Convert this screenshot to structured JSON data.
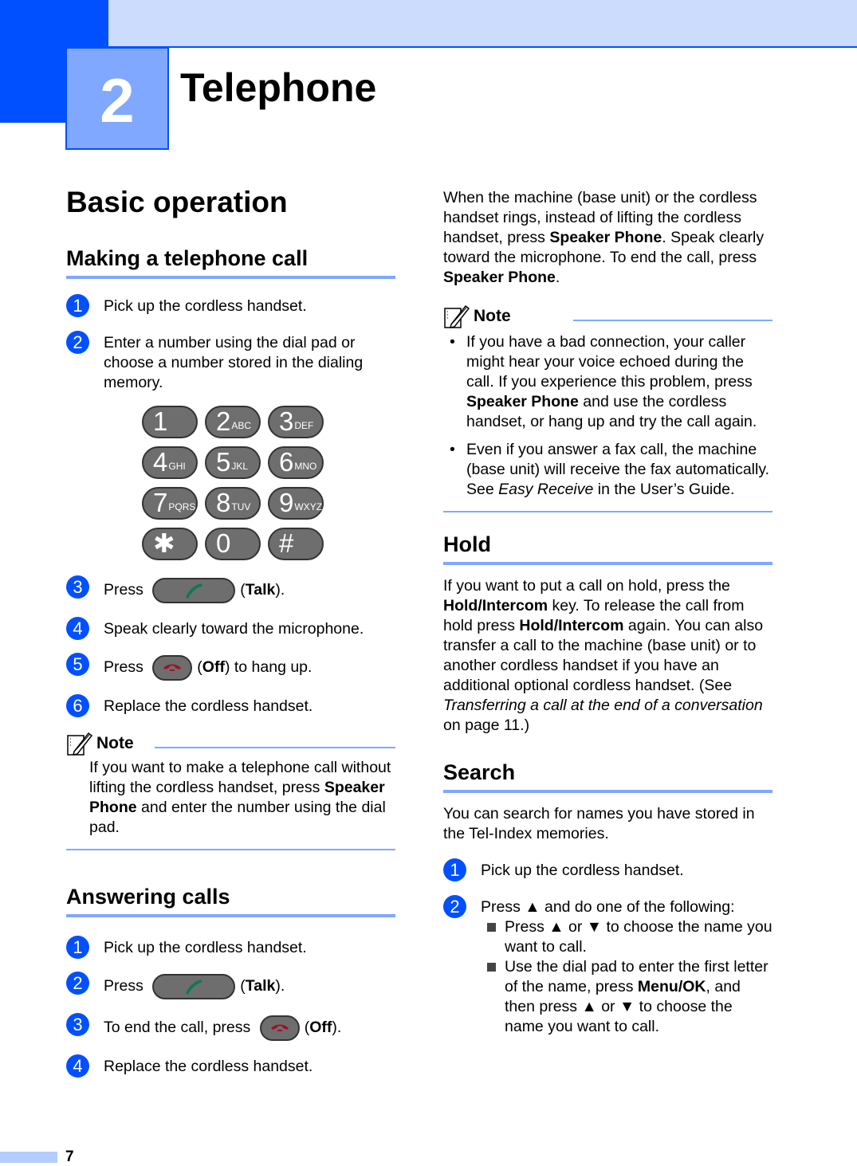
{
  "chapter": {
    "number": "2",
    "title": "Telephone"
  },
  "left": {
    "section_title": "Basic operation",
    "making_call": {
      "title": "Making a telephone call",
      "steps": [
        {
          "num": "1",
          "text": "Pick up the cordless handset."
        },
        {
          "num": "2",
          "text": "Enter a number using the dial pad or choose a number stored in the dialing memory."
        },
        {
          "num": "3",
          "pre": "Press",
          "btn": "talk",
          "bold": "Talk",
          "post": ")."
        },
        {
          "num": "4",
          "text": "Speak clearly toward the microphone."
        },
        {
          "num": "5",
          "pre": "Press",
          "btn": "off",
          "bold": "Off",
          "post": ") to hang up."
        },
        {
          "num": "6",
          "text": "Replace the cordless handset."
        }
      ],
      "keypad": [
        {
          "digit": "1",
          "letters": ""
        },
        {
          "digit": "2",
          "letters": "ABC"
        },
        {
          "digit": "3",
          "letters": "DEF"
        },
        {
          "digit": "4",
          "letters": "GHI"
        },
        {
          "digit": "5",
          "letters": "JKL"
        },
        {
          "digit": "6",
          "letters": "MNO"
        },
        {
          "digit": "7",
          "letters": "PQRS"
        },
        {
          "digit": "8",
          "letters": "TUV"
        },
        {
          "digit": "9",
          "letters": "WXYZ"
        },
        {
          "digit": "✱",
          "letters": ""
        },
        {
          "digit": "0",
          "letters": ""
        },
        {
          "digit": "#",
          "letters": ""
        }
      ],
      "note": {
        "label": "Note",
        "t1": "If you want to make a telephone call without lifting the cordless handset, press ",
        "b1": "Speaker Phone",
        "t2": " and enter the number using the dial pad."
      }
    },
    "answering": {
      "title": "Answering calls",
      "steps": [
        {
          "num": "1",
          "text": "Pick up the cordless handset."
        },
        {
          "num": "2",
          "pre": "Press",
          "bold": "Talk",
          "post": ")."
        },
        {
          "num": "3",
          "pre": "To end the call, press",
          "bold": "Off",
          "post": ")."
        },
        {
          "num": "4",
          "text": "Replace the cordless handset."
        }
      ]
    }
  },
  "right": {
    "speaker": {
      "t1": "When the machine (base unit) or the cordless handset rings, instead of lifting the cordless handset, press ",
      "b1": "Speaker Phone",
      "t2": ". Speak clearly toward the microphone. To end the call, press ",
      "b2": "Speaker Phone",
      "t3": "."
    },
    "note": {
      "label": "Note",
      "bullet1": {
        "t1": "If you have a bad connection, your caller might hear your voice echoed during the call. If you experience this problem, press ",
        "b1": "Speaker Phone",
        "t2": " and use the cordless handset, or hang up and try the call again."
      },
      "bullet2": {
        "t1": "Even if you answer a fax call, the machine (base unit) will receive the fax automatically. See ",
        "i1": "Easy Receive",
        "t2": " in the User’s Guide."
      }
    },
    "hold": {
      "title": "Hold",
      "t1": "If you want to put a call on hold, press the ",
      "b1": "Hold/Intercom",
      "t2": " key. To release the call from hold press ",
      "b2": "Hold/Intercom",
      "t3": " again. You can also transfer a call to the machine (base unit) or to another cordless handset if you have an additional optional cordless handset. (See ",
      "i1": "Transferring a call at the end of a conversation",
      "t4": " on page 11.)"
    },
    "search": {
      "title": "Search",
      "intro": "You can search for names you have stored in the Tel-Index memories.",
      "step1": {
        "num": "1",
        "text": "Pick up the cordless handset."
      },
      "step2": {
        "num": "2",
        "t1": "Press ▲ and do one of the following:"
      },
      "sub1": "Press ▲ or ▼ to choose the name you want to call.",
      "sub2": {
        "t1": "Use the dial pad to enter the first letter of the name, press ",
        "b1": "Menu/OK",
        "t2": ", and then press ▲ or ▼ to choose the name you want to call."
      }
    }
  },
  "footer": {
    "page": "7"
  },
  "colors": {
    "brand_blue": "#0050ff",
    "accent_blue": "#80a8ff",
    "light_blue": "#ccdcfc",
    "talk_green": "#0a7a5a",
    "off_red": "#a0102a"
  }
}
